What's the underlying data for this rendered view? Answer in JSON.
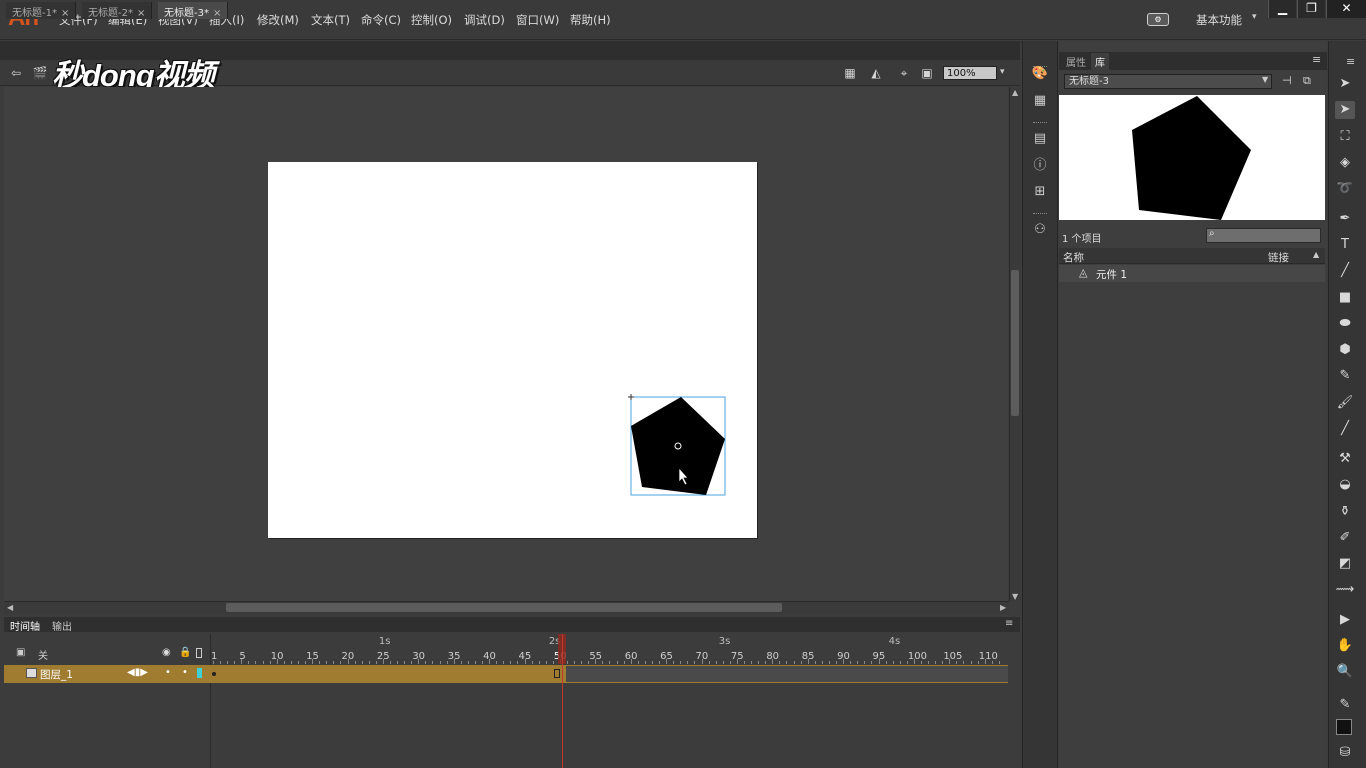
{
  "app": {
    "logo": "An"
  },
  "menu": [
    "文件(F)",
    "编辑(E)",
    "视图(V)",
    "插入(I)",
    "修改(M)",
    "文本(T)",
    "命令(C)",
    "控制(O)",
    "调试(D)",
    "窗口(W)",
    "帮助(H)"
  ],
  "workspace": {
    "label": "基本功能",
    "arrow": "▾"
  },
  "window_controls": {
    "minimize": "▁",
    "restore": "❐",
    "close": "✕"
  },
  "doc_tabs": [
    {
      "label": "无标题-1*",
      "close": "×"
    },
    {
      "label": "无标题-2*",
      "close": "×"
    },
    {
      "label": "无标题-3*",
      "close": "×"
    }
  ],
  "watermark": "秒dong视频",
  "editbar": {
    "zoom": "100%",
    "zoom_arrow": "▾"
  },
  "timeline": {
    "tabs": [
      "时间轴",
      "输出"
    ],
    "camera_label": "关",
    "layer_name": "图层_1",
    "frame_numbers": [
      "1",
      "5",
      "10",
      "15",
      "20",
      "25",
      "30",
      "35",
      "40",
      "45",
      "50",
      "55",
      "60",
      "65",
      "70",
      "75",
      "80",
      "85",
      "90",
      "95",
      "100",
      "105",
      "110"
    ],
    "seconds": [
      "1s",
      "2s",
      "3s",
      "4s"
    ],
    "current_frame": "50"
  },
  "library": {
    "tabs": [
      "属性",
      "库"
    ],
    "active_tab": "库",
    "document": "无标题-3",
    "item_count": "1 个项目",
    "columns": {
      "name": "名称",
      "linkage": "链接"
    },
    "items": [
      {
        "name": "元件 1",
        "icon": "movieclip-icon"
      }
    ]
  },
  "tools": [
    "selection-tool",
    "subselection-tool",
    "free-transform-tool",
    "3d-rotation-tool",
    "lasso-tool",
    "pen-tool",
    "text-tool",
    "line-tool",
    "rectangle-tool",
    "oval-tool",
    "polystar-tool",
    "pencil-tool",
    "paint-brush-tool",
    "brush-tool",
    "bone-tool",
    "paint-bucket-tool",
    "ink-bottle-tool",
    "eyedropper-tool",
    "eraser-tool",
    "width-tool",
    "camera-tool",
    "hand-tool",
    "zoom-tool",
    "stroke-color",
    "fill-color"
  ],
  "colors": {
    "accent": "#d4541e",
    "layer_highlight": "#a07c30",
    "playhead": "#c0392b",
    "selection_box": "#4aa3e0"
  }
}
